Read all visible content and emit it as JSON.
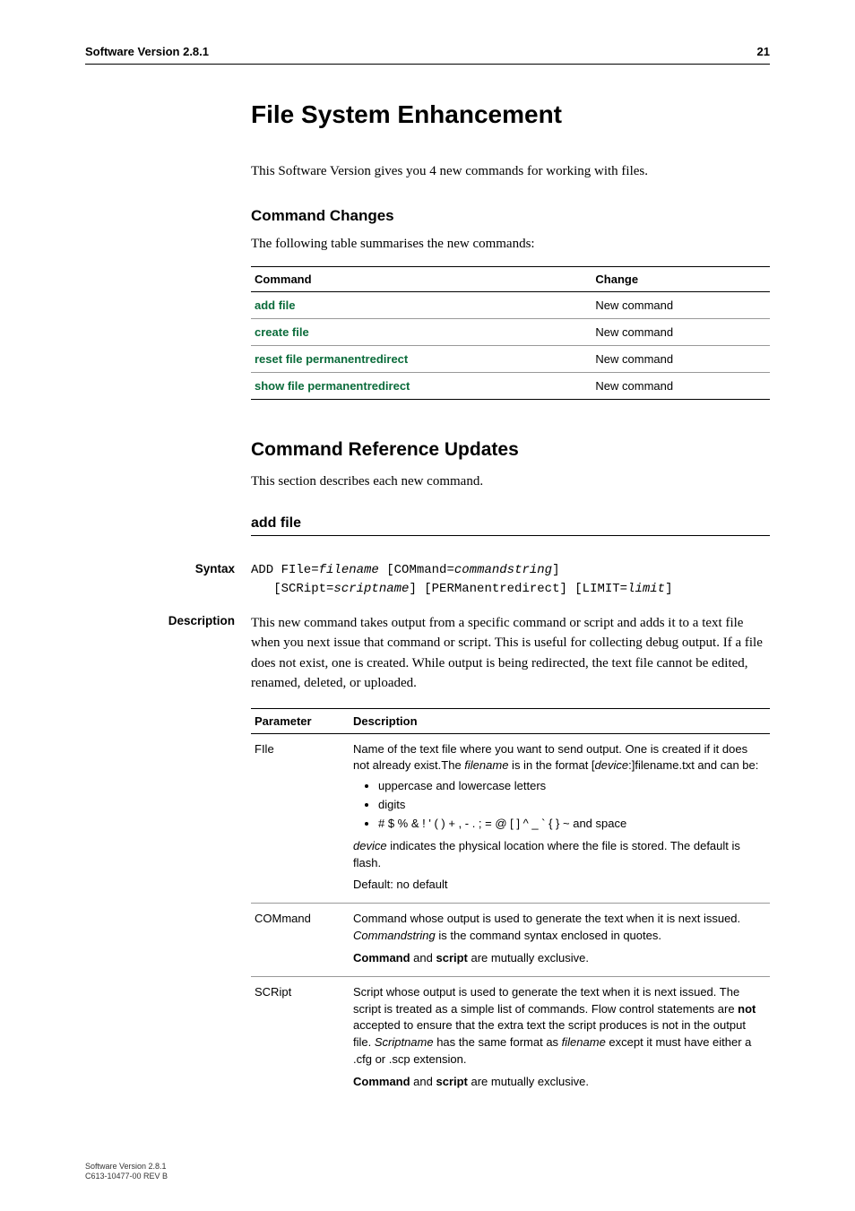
{
  "header": {
    "left": "Software Version 2.8.1",
    "right": "21"
  },
  "title": "File System Enhancement",
  "intro": "This Software Version gives you 4 new commands for working with files.",
  "changes": {
    "heading": "Command Changes",
    "lead": "The following table summarises the new commands:",
    "col1": "Command",
    "col2": "Change",
    "rows": [
      {
        "cmd": "add file",
        "chg": "New command"
      },
      {
        "cmd": "create file",
        "chg": "New command"
      },
      {
        "cmd": "reset file permanentredirect",
        "chg": "New command"
      },
      {
        "cmd": "show file permanentredirect",
        "chg": "New command"
      }
    ]
  },
  "ref": {
    "heading": "Command Reference Updates",
    "lead": "This section describes each new command."
  },
  "addfile": {
    "heading": "add file",
    "syntax_label": "Syntax",
    "syntax_l1a": "ADD FIle=",
    "syntax_l1b": "filename",
    "syntax_l1c": " [COMmand=",
    "syntax_l1d": "commandstring",
    "syntax_l1e": "]",
    "syntax_l2a": "   [SCRipt=",
    "syntax_l2b": "scriptname",
    "syntax_l2c": "] [PERManentredirect] [LIMIT=",
    "syntax_l2d": "limit",
    "syntax_l2e": "]",
    "desc_label": "Description",
    "desc_text": "This new command takes output from a specific command or script and adds it to a text file when you next issue that command or script. This is useful for collecting debug output. If a file does not exist, one is created. While output is being redirected, the text file cannot be edited, renamed, deleted, or uploaded.",
    "param_h1": "Parameter",
    "param_h2": "Description",
    "p_file_name": "FIle",
    "p_file_d1a": "Name of the text file where you want to send output. One is created if it does not already exist.The ",
    "p_file_d1b": "filename",
    "p_file_d1c": " is in the format [",
    "p_file_d1d": "device",
    "p_file_d1e": ":]filename.txt and can be:",
    "p_file_b1": "uppercase and lowercase letters",
    "p_file_b2": "digits",
    "p_file_b3": "# $ % & ! ' ( ) + , - . ; = @ [ ] ^ _ ` { } ~ and space",
    "p_file_d2a": "device",
    "p_file_d2b": " indicates the physical location where the file is stored. The default is flash.",
    "p_file_d3": "Default: no default",
    "p_com_name": "COMmand",
    "p_com_d1a": "Command whose output is used to generate the text when it is next issued. ",
    "p_com_d1b": "Commandstring",
    "p_com_d1c": " is the command syntax enclosed in quotes.",
    "p_com_d2a": "Command",
    "p_com_d2b": " and ",
    "p_com_d2c": "script",
    "p_com_d2d": " are mutually exclusive.",
    "p_scr_name": "SCRipt",
    "p_scr_d1a": "Script whose output is used to generate the text when it is next issued. The script is treated as a simple list of commands. Flow control statements are ",
    "p_scr_d1b": "not",
    "p_scr_d1c": " accepted to ensure that the extra text the script produces is not in the output file. ",
    "p_scr_d1d": "Scriptname",
    "p_scr_d1e": " has the same format as ",
    "p_scr_d1f": "filename",
    "p_scr_d1g": " except it must have either a .cfg or .scp extension.",
    "p_scr_d2a": "Command",
    "p_scr_d2b": " and ",
    "p_scr_d2c": "script",
    "p_scr_d2d": " are mutually exclusive."
  },
  "footer": {
    "l1": "Software Version 2.8.1",
    "l2": "C613-10477-00 REV B"
  }
}
